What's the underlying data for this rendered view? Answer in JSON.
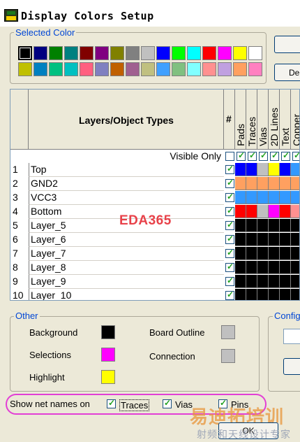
{
  "window": {
    "title": "Display Colors Setup",
    "icon": "pads-logo-icon"
  },
  "selected_color": {
    "label": "Selected Color",
    "row1": [
      "#000000",
      "#000080",
      "#008000",
      "#008080",
      "#800000",
      "#800080",
      "#808000",
      "#808080",
      "#c0c0c0",
      "#0000ff",
      "#00ff00",
      "#00ffff",
      "#ff0000",
      "#ff00ff",
      "#ffff00",
      "#ffffff"
    ],
    "row2": [
      "#c0c000",
      "#0080c0",
      "#00c080",
      "#00c0c0",
      "#ff6080",
      "#8080c0",
      "#c06000",
      "#a06090",
      "#c0c080",
      "#40a0ff",
      "#80c080",
      "#80ffff",
      "#ff9090",
      "#c0a0e0",
      "#ffa060",
      "#ff80c0"
    ]
  },
  "right_buttons": {
    "btn1": "",
    "btn2": "De"
  },
  "grid": {
    "header_title": "Layers/Object Types",
    "hash": "#",
    "columns": [
      "Pads",
      "Traces",
      "Vias",
      "2D Lines",
      "Text",
      "Copper"
    ],
    "visible_only": "Visible Only",
    "rows": [
      {
        "num": "1",
        "name": "Top",
        "colors": [
          "#0000ff",
          "#0000ff",
          "#c0c0c0",
          "#ffff00",
          "#0000ff",
          "#3399ff"
        ]
      },
      {
        "num": "2",
        "name": "GND2",
        "colors": [
          "#ffa060",
          "#ffa060",
          "#ffa060",
          "#ffa060",
          "#ffa060",
          "#ffa060"
        ]
      },
      {
        "num": "3",
        "name": "VCC3",
        "colors": [
          "#3399ff",
          "#3399ff",
          "#3399ff",
          "#3399ff",
          "#3399ff",
          "#3399ff"
        ]
      },
      {
        "num": "4",
        "name": "Bottom",
        "colors": [
          "#ff0000",
          "#ff0000",
          "#c0c0c0",
          "#ff00ff",
          "#ff0000",
          "#ff9090"
        ]
      },
      {
        "num": "5",
        "name": "Layer_5",
        "colors": [
          "#000000",
          "#000000",
          "#000000",
          "#000000",
          "#000000",
          "#000000"
        ]
      },
      {
        "num": "6",
        "name": "Layer_6",
        "colors": [
          "#000000",
          "#000000",
          "#000000",
          "#000000",
          "#000000",
          "#000000"
        ]
      },
      {
        "num": "7",
        "name": "Layer_7",
        "colors": [
          "#000000",
          "#000000",
          "#000000",
          "#000000",
          "#000000",
          "#000000"
        ]
      },
      {
        "num": "8",
        "name": "Layer_8",
        "colors": [
          "#000000",
          "#000000",
          "#000000",
          "#000000",
          "#000000",
          "#000000"
        ]
      },
      {
        "num": "9",
        "name": "Layer_9",
        "colors": [
          "#000000",
          "#000000",
          "#000000",
          "#000000",
          "#000000",
          "#000000"
        ]
      },
      {
        "num": "10",
        "name": "Layer_10",
        "colors": [
          "#000000",
          "#000000",
          "#000000",
          "#000000",
          "#000000",
          "#000000"
        ]
      }
    ]
  },
  "watermark_center": "EDA365",
  "other": {
    "label": "Other",
    "background": "Background",
    "selections": "Selections",
    "highlight": "Highlight",
    "board_outline": "Board Outline",
    "connection": "Connection",
    "colors": {
      "background": "#000000",
      "selections": "#ff00ff",
      "highlight": "#ffff00",
      "board_outline": "#c0c0c0",
      "connection": "#c0c0c0"
    }
  },
  "config": {
    "label": "Config"
  },
  "net_names": {
    "label": "Show net names on",
    "traces": "Traces",
    "vias": "Vias",
    "pins": "Pins"
  },
  "ok_button": "OK",
  "watermark_bottom": {
    "main": "易迪拓培训",
    "sub": "射频和天线设计专家"
  }
}
